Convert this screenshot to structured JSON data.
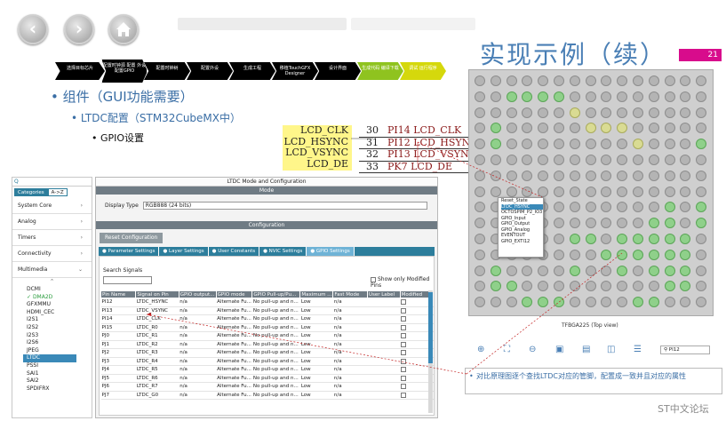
{
  "nav": {
    "back_glyph": "‹",
    "forward_glyph": "›"
  },
  "slide": {
    "title": "实现示例（续）",
    "page_number": "21",
    "bullet1": "• 组件（GUI功能需要）",
    "bullet2": "• LTDC配置（STM32CubeMX中）",
    "bullet3": "• GPIO设置"
  },
  "steps": [
    {
      "label": "选择目标芯片"
    },
    {
      "label": "配置时钟源 配置 外设 配置GPIO"
    },
    {
      "label": "配置时钟树"
    },
    {
      "label": "配置外设"
    },
    {
      "label": "生成工程"
    },
    {
      "label": "移植TouchGFX Designer"
    },
    {
      "label": "设计界面"
    },
    {
      "label": "生成代码 编译下载"
    },
    {
      "label": "调试 运行程序"
    }
  ],
  "lcd_table": {
    "left": [
      "LCD_CLK",
      "LCD_HSYNC",
      "LCD_VSYNC",
      "LCD_DE"
    ],
    "right": [
      {
        "num": "30",
        "sig": "PI14  LCD_CLK"
      },
      {
        "num": "31",
        "sig": "PI12  LCD_HSYNC"
      },
      {
        "num": "32",
        "sig": "PI13  LCD_VSYNC"
      },
      {
        "num": "33",
        "sig": "PK7  LCD_DE"
      }
    ]
  },
  "left_pane": {
    "search_icon": "Q",
    "tab_categories": "Categories",
    "tab_az": "A->Z",
    "categories": [
      {
        "label": "System Core"
      },
      {
        "label": "Analog"
      },
      {
        "label": "Timers"
      },
      {
        "label": "Connectivity"
      },
      {
        "label": "Multimedia"
      }
    ],
    "up_arrow": "⌃",
    "multimedia_items": [
      "DCMI",
      "DMA2D",
      "GFXMMU",
      "HDMI_CEC",
      "I2S1",
      "I2S2",
      "I2S3",
      "I2S6",
      "JPEG",
      "LTDC",
      "PSSI",
      "SAI1",
      "SAI2",
      "SPDIFRX"
    ]
  },
  "cube_window": {
    "title": "LTDC Mode and Configuration",
    "mode_header": "Mode",
    "display_type_label": "Display Type",
    "display_type_value": "RGB888 (24 bits)",
    "config_header": "Configuration",
    "reset_button": "Reset Configuration",
    "tabs": [
      "● Parameter Settings",
      "● Layer Settings",
      "● User Constants",
      "● NVIC Settings",
      "● GPIO Settings"
    ],
    "search_signals_label": "Search Signals",
    "show_modified_label": "Show only Modified Pins",
    "columns": [
      "Pin Name",
      "Signal on Pin",
      "GPIO output...",
      "GPIO mode",
      "GPIO Pull-up/Pu...",
      "Maximum ...",
      "Fast Mode",
      "User Label",
      "Modified"
    ],
    "rows": [
      [
        "PI12",
        "LTDC_HSYNC",
        "n/a",
        "Alternate Fu...",
        "No pull-up and n...",
        "Low",
        "n/a",
        "",
        ""
      ],
      [
        "PI13",
        "LTDC_VSYNC",
        "n/a",
        "Alternate Fu...",
        "No pull-up and n...",
        "Low",
        "n/a",
        "",
        ""
      ],
      [
        "PI14",
        "LTDC_CLK",
        "n/a",
        "Alternate Fu...",
        "No pull-up and n...",
        "Low",
        "n/a",
        "",
        ""
      ],
      [
        "PI15",
        "LTDC_R0",
        "n/a",
        "Alternate Fu...",
        "No pull-up and n...",
        "Low",
        "n/a",
        "",
        ""
      ],
      [
        "PJ0",
        "LTDC_R1",
        "n/a",
        "Alternate Fu...",
        "No pull-up and n...",
        "Low",
        "n/a",
        "",
        ""
      ],
      [
        "PJ1",
        "LTDC_R2",
        "n/a",
        "Alternate Fu...",
        "No pull-up and n...",
        "Low",
        "n/a",
        "",
        ""
      ],
      [
        "PJ2",
        "LTDC_R3",
        "n/a",
        "Alternate Fu...",
        "No pull-up and n...",
        "Low",
        "n/a",
        "",
        ""
      ],
      [
        "PJ3",
        "LTDC_R4",
        "n/a",
        "Alternate Fu...",
        "No pull-up and n...",
        "Low",
        "n/a",
        "",
        ""
      ],
      [
        "PJ4",
        "LTDC_R5",
        "n/a",
        "Alternate Fu...",
        "No pull-up and n...",
        "Low",
        "n/a",
        "",
        ""
      ],
      [
        "PJ5",
        "LTDC_R6",
        "n/a",
        "Alternate Fu...",
        "No pull-up and n...",
        "Low",
        "n/a",
        "",
        ""
      ],
      [
        "PJ6",
        "LTDC_R7",
        "n/a",
        "Alternate Fu...",
        "No pull-up and n...",
        "Low",
        "n/a",
        "",
        ""
      ],
      [
        "PJ7",
        "LTDC_G0",
        "n/a",
        "Alternate Fu...",
        "No pull-up and n...",
        "Low",
        "n/a",
        "",
        ""
      ]
    ]
  },
  "chip": {
    "package_label": "TFBGA225 (Top view)",
    "popup_items": [
      "Reset_State",
      "LTDC_HSYNC",
      "OCTOSPIM_P2_IO3",
      "GPIO_Input",
      "GPIO_Output",
      "GPIO_Analog",
      "EVENTOUT",
      "GPIO_EXTI12"
    ],
    "pin_search_value": "PI12"
  },
  "toolbar_icons": [
    "zoom-in-icon",
    "fit-icon",
    "zoom-out-icon",
    "export-icon",
    "import-icon",
    "split-icon",
    "list-icon",
    "search-icon"
  ],
  "note": "对比原理图逐个查找LTDC对应的管脚，配置成一致并且对应的属性",
  "watermark": "ST中文论坛",
  "colors": {
    "accent": "#4a7fb5",
    "magenta": "#d80c8c",
    "highlight": "#fff68a",
    "tab_blue": "#2d7e9c",
    "pin_green": "#8fd08a"
  }
}
